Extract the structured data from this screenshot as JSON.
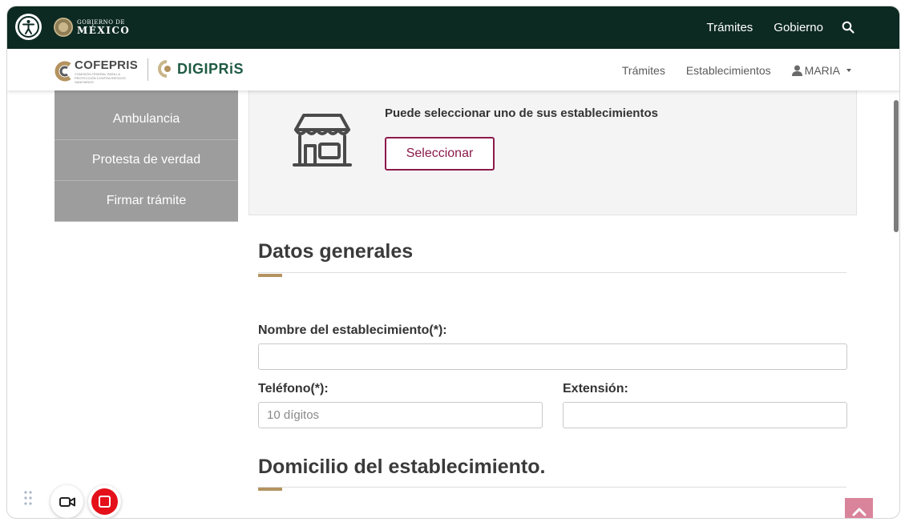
{
  "gob_bar": {
    "logo_line1": "GOBIERNO DE",
    "logo_line2": "MÉXICO",
    "nav": [
      "Trámites",
      "Gobierno"
    ],
    "accessibility_icon": "accessibility-icon",
    "search_icon": "search-icon",
    "background_color": "#0d2a22"
  },
  "sub_bar": {
    "cofepris_name": "COFEPRIS",
    "cofepris_tagline": "COMISIÓN FEDERAL PARA LA PROTECCIÓN CONTRA RIESGOS SANITARIOS",
    "digipris_name": "DIGIPRiS",
    "nav": {
      "tramites": "Trámites",
      "establecimientos": "Establecimientos",
      "user": "MARIA"
    },
    "user_icon": "user-icon"
  },
  "sidebar": {
    "items": [
      "Ambulancia",
      "Protesta de verdad",
      "Firmar trámite"
    ]
  },
  "establishment": {
    "message": "Puede seleccionar uno de sus establecimientos",
    "button_label": "Seleccionar",
    "icon": "store-icon",
    "accent_color": "#8b1a4a"
  },
  "datos_generales": {
    "title": "Datos generales",
    "nombre_label": "Nombre del establecimiento(*):",
    "nombre_value": "",
    "telefono_label": "Teléfono(*):",
    "telefono_placeholder": "10 dígitos",
    "extension_label": "Extensión:",
    "extension_value": ""
  },
  "domicilio": {
    "title": "Domicilio del establecimiento."
  },
  "recorder": {
    "camera_icon": "video-camera-icon",
    "stop_icon": "stop-record-icon",
    "drag_icon": "drag-handle-icon"
  },
  "back_to_top_icon": "chevron-up-icon",
  "title_accent_color": "#b49360"
}
